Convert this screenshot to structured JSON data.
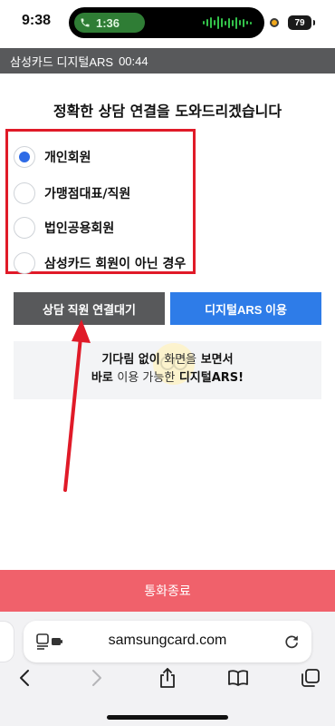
{
  "status_bar": {
    "time": "9:38",
    "call_timer": "1:36",
    "battery": "79"
  },
  "title_bar": {
    "service": "삼성카드 디지털ARS",
    "timer": "00:44"
  },
  "headline": "정확한 상담 연결을 도와드리겠습니다",
  "options": {
    "items": [
      {
        "label": "개인회원",
        "checked": true
      },
      {
        "label": "가맹점대표/직원",
        "checked": false
      },
      {
        "label": "법인공용회원",
        "checked": false
      },
      {
        "label": "삼성카드 회원이 아닌 경우",
        "checked": false
      }
    ]
  },
  "buttons": {
    "wait_label": "상담 직원 연결대기",
    "ars_label": "디지털ARS 이용"
  },
  "info": {
    "line1_a": "기다림 없이",
    "line1_b": "화면을",
    "line1_c": "보면서",
    "line2_a": "바로",
    "line2_b": "이용 가능한",
    "line2_c": "디지털ARS!"
  },
  "end_call_label": "통화종료",
  "browser": {
    "url": "samsungcard.com"
  },
  "colors": {
    "title_bar_bg": "#58595b",
    "primary_blue": "#2e7ce8",
    "end_call_bg": "#f0616b",
    "highlight_red": "#e01a28",
    "call_green": "#2f7d35"
  },
  "icons": [
    "phone-icon",
    "audio-wave-icon",
    "battery-icon",
    "reader-icon",
    "reload-icon",
    "back-icon",
    "forward-icon",
    "share-icon",
    "bookmarks-icon",
    "tabs-icon"
  ]
}
